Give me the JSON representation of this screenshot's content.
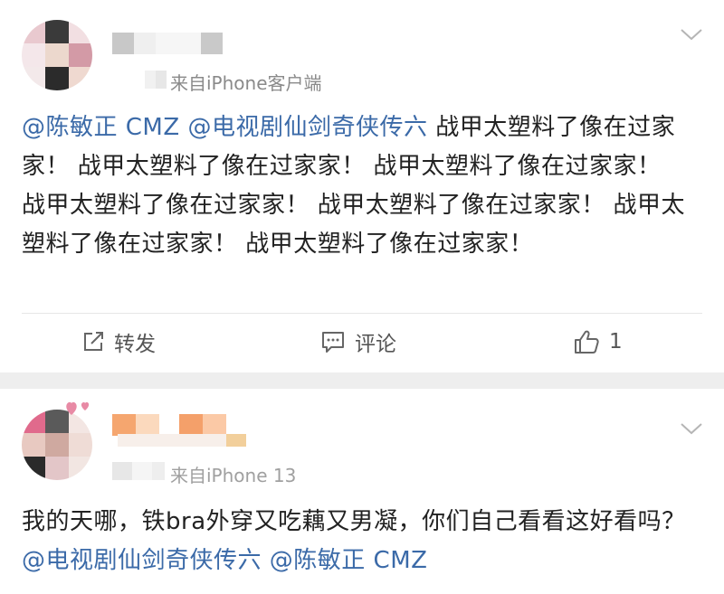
{
  "post1": {
    "source_text": "来自iPhone客户端",
    "content": {
      "mention_1": "@陈敏正 CMZ",
      "mention_2": "@电视剧仙剑奇侠传六",
      "body": "战甲太塑料了像在过家家！ 战甲太塑料了像在过家家！ 战甲太塑料了像在过家家！ 战甲太塑料了像在过家家！ 战甲太塑料了像在过家家！ 战甲太塑料了像在过家家！ 战甲太塑料了像在过家家！"
    },
    "actions": {
      "repost_label": "转发",
      "comment_label": "评论",
      "like_count": "1"
    }
  },
  "post2": {
    "source_text": "来自iPhone 13",
    "content": {
      "body": "我的天哪，铁bra外穿又吃藕又男凝，你们自己看看这好看吗？",
      "mention_1": "@电视剧仙剑奇侠传六",
      "mention_2": "@陈敏正 CMZ"
    }
  },
  "icons": {
    "repost": "repost-icon",
    "comment": "comment-icon",
    "like": "thumbs-up-icon",
    "more": "chevron-down-icon"
  },
  "colors": {
    "mention": "#3b6aa8",
    "text": "#222222",
    "muted": "#8a8a8a",
    "separator": "#eeeeee"
  }
}
